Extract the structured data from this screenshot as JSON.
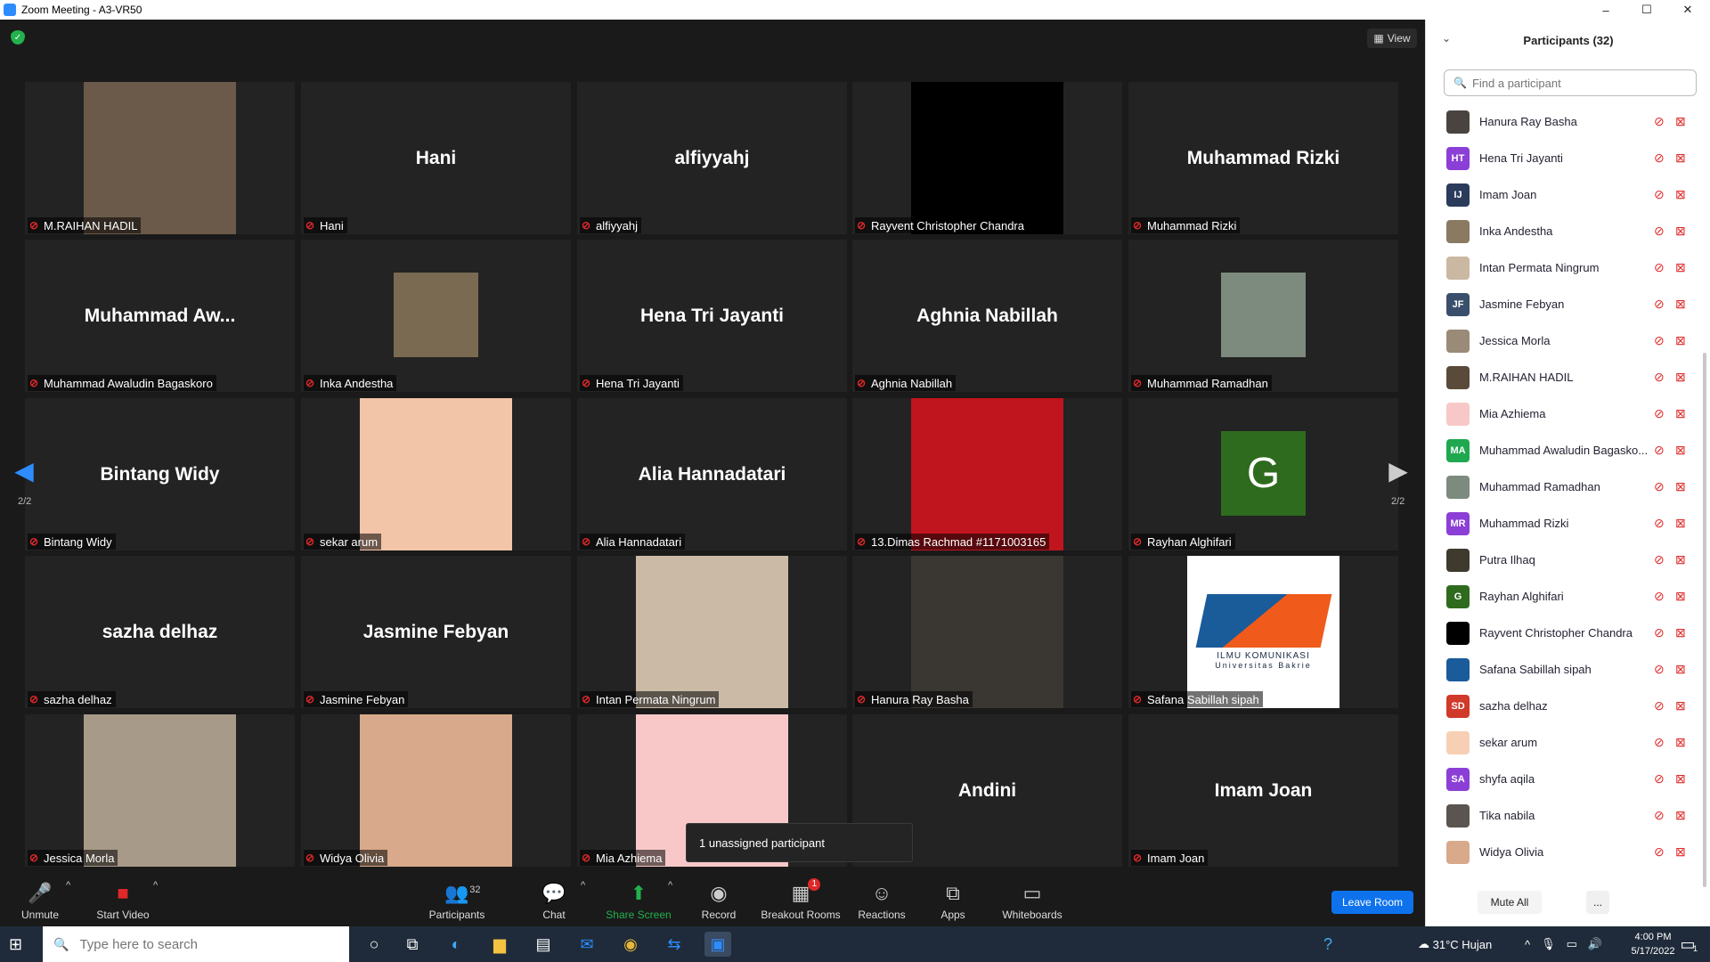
{
  "window": {
    "title": "Zoom Meeting - A3-VR50",
    "controls": [
      "–",
      "☐",
      "✕"
    ]
  },
  "view_button": {
    "label": "View"
  },
  "page_indicator": {
    "left": "2/2",
    "right": "2/2"
  },
  "tiles": [
    {
      "display": "",
      "label": "M.RAIHAN HADIL",
      "video": true,
      "bg": "#6b5a4a"
    },
    {
      "display": "Hani",
      "label": "Hani"
    },
    {
      "display": "alfiyyahj",
      "label": "alfiyyahj"
    },
    {
      "display": "",
      "label": "Rayvent Christopher Chandra",
      "video": true,
      "bg": "#000000"
    },
    {
      "display": "Muhammad Rizki",
      "label": "Muhammad Rizki"
    },
    {
      "display": "Muhammad  Aw...",
      "label": "Muhammad Awaludin Bagaskoro"
    },
    {
      "display": "",
      "label": "Inka Andestha",
      "video": true,
      "bg": "#7a6a52",
      "small": true
    },
    {
      "display": "Hena Tri Jayanti",
      "label": "Hena Tri Jayanti"
    },
    {
      "display": "Aghnia Nabillah",
      "label": "Aghnia Nabillah"
    },
    {
      "display": "",
      "label": "Muhammad Ramadhan",
      "video": true,
      "bg": "#7d8a7e",
      "small": true
    },
    {
      "display": "Bintang Widy",
      "label": "Bintang Widy"
    },
    {
      "display": "",
      "label": "sekar arum",
      "video": true,
      "bg": "#f2c4a8"
    },
    {
      "display": "Alia Hannadatari",
      "label": "Alia Hannadatari"
    },
    {
      "display": "",
      "label": "13.Dimas Rachmad #1171003165",
      "video": true,
      "bg": "#c0141e"
    },
    {
      "display": "G",
      "label": "Rayhan Alghifari",
      "avatar": true,
      "bg": "#2e6b1e"
    },
    {
      "display": "sazha delhaz",
      "label": "sazha delhaz"
    },
    {
      "display": "Jasmine Febyan",
      "label": "Jasmine Febyan"
    },
    {
      "display": "",
      "label": "Intan Permata Ningrum",
      "video": true,
      "bg": "#cbbba6"
    },
    {
      "display": "",
      "label": "Hanura Ray Basha",
      "video": true,
      "bg": "#3a3632"
    },
    {
      "display": "",
      "label": "Safana Sabillah sipah",
      "logo": true,
      "bg": "#ffffff",
      "logo_text": "ILMU KOMUNIKASI",
      "logo_sub": "Universitas Bakrie"
    },
    {
      "display": "",
      "label": "Jessica Morla",
      "video": true,
      "bg": "#a89a88"
    },
    {
      "display": "",
      "label": "Widya Olivia",
      "video": true,
      "bg": "#d8a98a"
    },
    {
      "display": "",
      "label": "Mia Azhiema",
      "video": true,
      "bg": "#f8c8c8"
    },
    {
      "display": "Andini",
      "label": ""
    },
    {
      "display": "Imam Joan",
      "label": "Imam Joan"
    }
  ],
  "tooltip": {
    "text": "1 unassigned participant"
  },
  "toolbar": {
    "unmute": "Unmute",
    "start_video": "Start Video",
    "participants": "Participants",
    "participants_count": "32",
    "chat": "Chat",
    "share_screen": "Share Screen",
    "record": "Record",
    "breakout_rooms": "Breakout Rooms",
    "breakout_badge": "1",
    "reactions": "Reactions",
    "apps": "Apps",
    "whiteboards": "Whiteboards",
    "leave_room": "Leave Room"
  },
  "panel": {
    "title": "Participants (32)",
    "search_placeholder": "Find a participant",
    "mute_all": "Mute All",
    "more": "...",
    "participants": [
      {
        "name": "Hanura Ray Basha",
        "initials": "",
        "color": "#4a4440"
      },
      {
        "name": "Hena Tri Jayanti",
        "initials": "HT",
        "color": "#8c3fd6"
      },
      {
        "name": "Imam Joan",
        "initials": "IJ",
        "color": "#2a3b5c"
      },
      {
        "name": "Inka Andestha",
        "initials": "",
        "color": "#8a7a62"
      },
      {
        "name": "Intan Permata Ningrum",
        "initials": "",
        "color": "#cbb8a2"
      },
      {
        "name": "Jasmine Febyan",
        "initials": "JF",
        "color": "#3a4f6c"
      },
      {
        "name": "Jessica Morla",
        "initials": "",
        "color": "#9a8a78"
      },
      {
        "name": "M.RAIHAN HADIL",
        "initials": "",
        "color": "#5a4a3a"
      },
      {
        "name": "Mia Azhiema",
        "initials": "",
        "color": "#f8c8c8"
      },
      {
        "name": "Muhammad Awaludin Bagasko...",
        "initials": "MA",
        "color": "#1fa84f"
      },
      {
        "name": "Muhammad Ramadhan",
        "initials": "",
        "color": "#7d8a7e"
      },
      {
        "name": "Muhammad Rizki",
        "initials": "MR",
        "color": "#8c3fd6"
      },
      {
        "name": "Putra Ilhaq",
        "initials": "",
        "color": "#3e3a2e"
      },
      {
        "name": "Rayhan Alghifari",
        "initials": "G",
        "color": "#2e6b1e"
      },
      {
        "name": "Rayvent Christopher Chandra",
        "initials": "",
        "color": "#000000"
      },
      {
        "name": "Safana Sabillah sipah",
        "initials": "",
        "color": "#1a5b9a"
      },
      {
        "name": "sazha delhaz",
        "initials": "SD",
        "color": "#d03a2a"
      },
      {
        "name": "sekar arum",
        "initials": "",
        "color": "#f7cfb4"
      },
      {
        "name": "shyfa aqila",
        "initials": "SA",
        "color": "#8c3fd6"
      },
      {
        "name": "Tika nabila",
        "initials": "",
        "color": "#5a5550"
      },
      {
        "name": "Widya Olivia",
        "initials": "",
        "color": "#d8a98a"
      }
    ]
  },
  "taskbar": {
    "search_placeholder": "Type here to search",
    "weather": "31°C  Hujan",
    "time": "4:00 PM",
    "date": "5/17/2022",
    "notification_count": "1"
  },
  "colors": {
    "accent": "#0e72ed",
    "muted": "#e02828",
    "share": "#23b14d"
  }
}
